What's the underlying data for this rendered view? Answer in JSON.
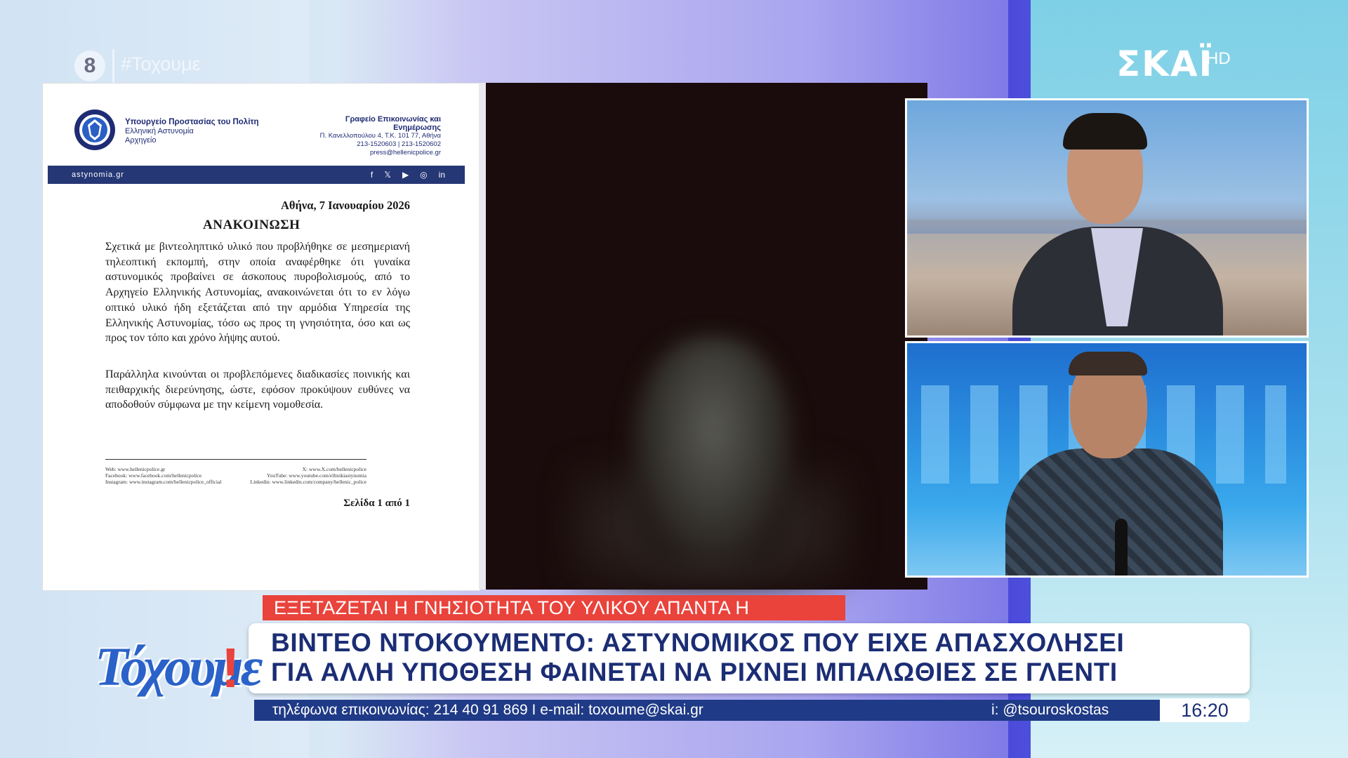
{
  "top_bar": {
    "channel_number": "8",
    "hashtag": "#Τοχουμε",
    "network_logo": "ΣΚΑΪ",
    "network_hd": "HD"
  },
  "document": {
    "ministry_lines": [
      "Υπουργείο Προστασίας του Πολίτη",
      "Ελληνική Αστυνομία",
      "Αρχηγείο"
    ],
    "office_title": "Γραφείο Επικοινωνίας και Ενημέρωσης",
    "office_address": "Π. Κανελλοπούλου 4, Τ.Κ. 101 77, Αθήνα",
    "office_phone": "213-1520603 | 213-1520602",
    "office_email": "press@hellenicpolice.gr",
    "bar_url": "astynomia.gr",
    "date": "Αθήνα, 7 Ιανουαρίου 2026",
    "title": "ΑΝΑΚΟΙΝΩΣΗ",
    "paragraph_1": "Σχετικά με βιντεοληπτικό υλικό που προβλήθηκε σε μεσημεριανή τηλεοπτική εκπομπή, στην οποία αναφέρθηκε ότι γυναίκα αστυνομικός προβαίνει σε άσκοπους πυροβολισμούς, από το Αρχηγείο Ελληνικής Αστυνομίας, ανακοινώνεται ότι το εν λόγω οπτικό υλικό ήδη εξετάζεται από την αρμόδια Υπηρεσία της Ελληνικής Αστυνομίας, τόσο ως προς τη γνησιότητα, όσο και ως προς τον τόπο και χρόνο λήψης αυτού.",
    "paragraph_2": "Παράλληλα κινούνται οι προβλεπόμενες διαδικασίες ποινικής και πειθαρχικής διερεύνησης, ώστε, εφόσον προκύψουν ευθύνες να αποδοθούν σύμφωνα με την κείμενη νομοθεσία.",
    "footer_left": [
      "Web: www.hellenicpolice.gr",
      "Facebook: www.facebook.com/hellenicpolice",
      "Instagram: www.instagram.com/hellenicpolice_official"
    ],
    "footer_right": [
      "X: www.X.com/hellenicpolice",
      "YouTube: www.youtube.com/ellinikiastynomia",
      "Linkedin: www.linkedin.com/company/hellenic_police"
    ],
    "page": "Σελίδα 1 από 1"
  },
  "lower_third": {
    "topic_tag": "ΕΞΕΤΑΖΕΤΑΙ Η ΓΝΗΣΙΟΤΗΤΑ ΤΟΥ ΥΛΙΚΟΥ ΑΠΑΝΤΑ Η ΑΣΤΥΝΟΜΙΑ",
    "headline_line_1": "ΒΙΝΤΕΟ ΝΤΟΚΟΥΜΕΝΤΟ: ΑΣΤΥΝΟΜΙΚΟΣ ΠΟΥ ΕΙΧΕ ΑΠΑΣΧΟΛΗΣΕΙ",
    "headline_line_2": "ΓΙΑ ΑΛΛΗ ΥΠΟΘΕΣΗ ΦΑΙΝΕΤΑΙ ΝΑ ΡΙΧΝΕΙ ΜΠΑΛΩΘΙΕΣ ΣΕ ΓΛΕΝΤΙ",
    "ticker_contact": "τηλέφωνα επικοινωνίας: 214 40 91 869  I  e-mail: toxoume@skai.gr",
    "ticker_handle": "i: @tsouroskostas",
    "clock": "16:20",
    "show_logo_text": "Τόχουμε",
    "show_logo_bang": "!"
  },
  "colors": {
    "accent_red": "#e9433b",
    "brand_blue": "#1b2d74",
    "ticker_blue": "#1f3a86"
  }
}
